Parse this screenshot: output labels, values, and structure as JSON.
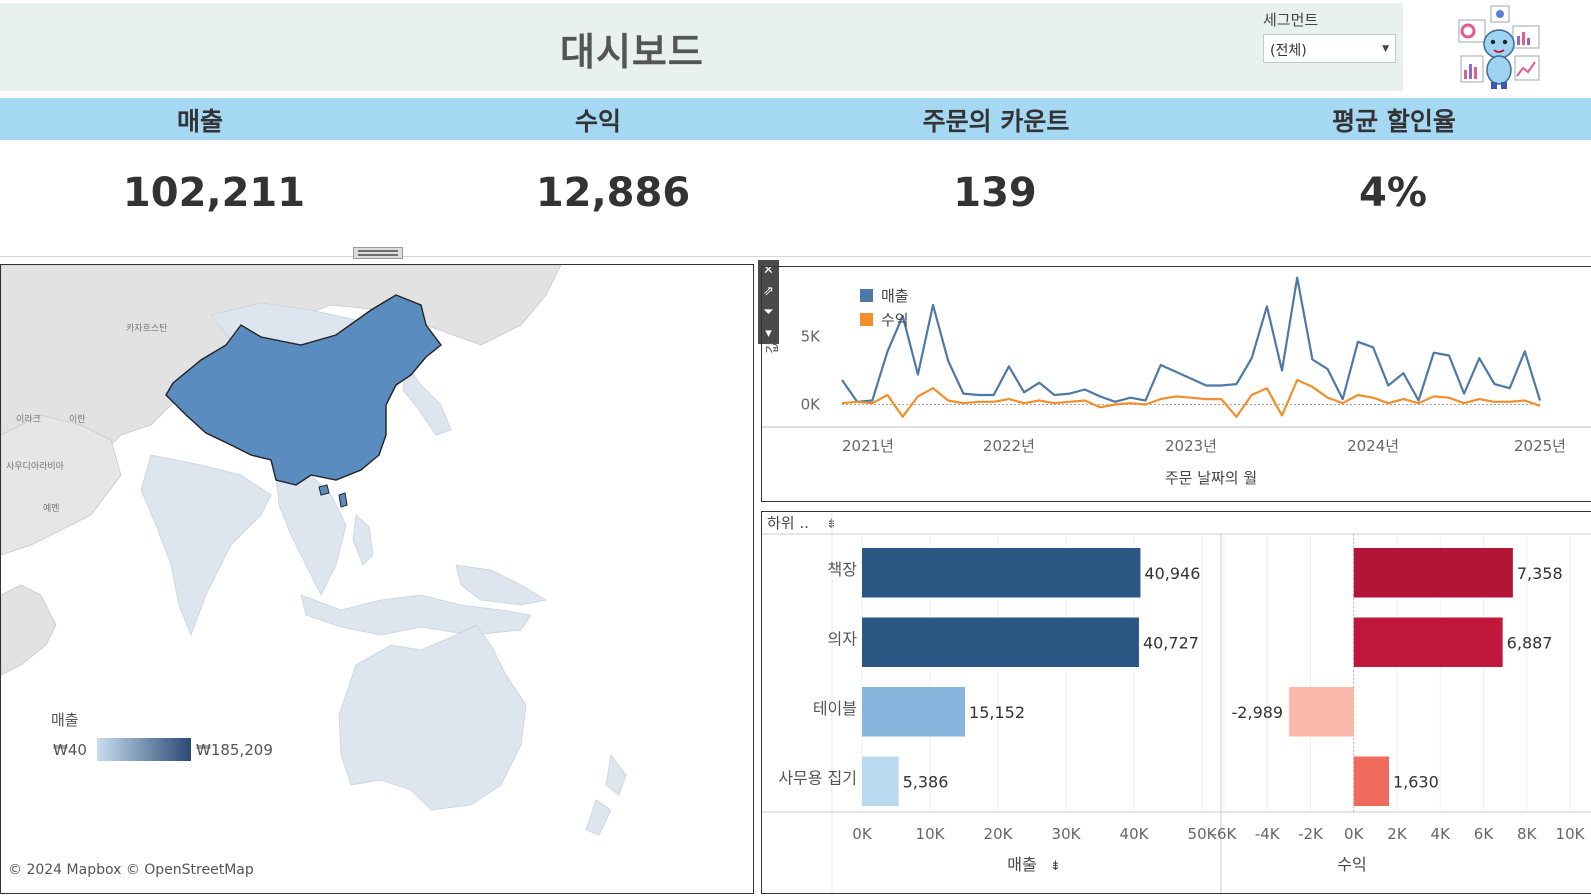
{
  "header": {
    "title": "대시보드",
    "segment_label": "세그먼트",
    "segment_value": "(전체)"
  },
  "kpis": [
    {
      "label": "매출",
      "value": "102,211"
    },
    {
      "label": "수익",
      "value": "12,886"
    },
    {
      "label": "주문의 카운트",
      "value": "139"
    },
    {
      "label": "평균 할인율",
      "value": "4%"
    }
  ],
  "map": {
    "labels": {
      "kazakhstan": "카자흐스탄",
      "iraq": "이라크",
      "iran": "이란",
      "saudi": "사우디아라비아",
      "yemen": "예멘"
    },
    "legend_title": "매출",
    "legend_min": "₩40",
    "legend_max": "₩185,209",
    "attribution": "© 2024 Mapbox © OpenStreetMap",
    "colors": {
      "highlight": "#5b8cc0",
      "light": "#dde5ee",
      "land": "#e2e2e2",
      "legend_low": "#c6dcef",
      "legend_high": "#2a4a73"
    }
  },
  "chart_data": [
    {
      "type": "line",
      "xlabel": "주문 날짜의 월",
      "ylabel": "값",
      "x_ticks": [
        "2021년",
        "2022년",
        "2023년",
        "2024년",
        "2025년"
      ],
      "y_ticks": [
        "0K",
        "5K"
      ],
      "ylim": [
        -1500,
        9500
      ],
      "legend_placement": "top-left",
      "series": [
        {
          "name": "매출",
          "color": "#4e79a7",
          "values": [
            1800,
            200,
            300,
            3900,
            6500,
            2200,
            7300,
            3200,
            800,
            700,
            700,
            2800,
            900,
            1600,
            700,
            800,
            1100,
            600,
            200,
            500,
            300,
            2900,
            2400,
            1900,
            1400,
            1400,
            1500,
            3400,
            7200,
            2500,
            9300,
            3300,
            2600,
            400,
            4600,
            4200,
            1400,
            2300,
            300,
            3800,
            3600,
            800,
            3400,
            1500,
            1200,
            3900,
            300
          ]
        },
        {
          "name": "수익",
          "color": "#f28e2b",
          "values": [
            100,
            200,
            100,
            700,
            -900,
            600,
            1200,
            300,
            100,
            200,
            200,
            400,
            100,
            300,
            100,
            200,
            300,
            -200,
            0,
            100,
            0,
            400,
            600,
            500,
            400,
            400,
            -900,
            700,
            1200,
            -800,
            1800,
            1300,
            500,
            100,
            700,
            500,
            100,
            400,
            100,
            600,
            500,
            100,
            400,
            200,
            200,
            300,
            -100
          ]
        }
      ]
    },
    {
      "type": "bar",
      "header_label": "하위 ..",
      "categories": [
        "책장",
        "의자",
        "테이블",
        "사무용 집기"
      ],
      "series": [
        {
          "name": "매출",
          "values": [
            40946,
            40727,
            15152,
            5386
          ],
          "value_labels": [
            "40,946",
            "40,727",
            "15,152",
            "5,386"
          ],
          "colors": [
            "#2a5783",
            "#2a5783",
            "#85b4dc",
            "#b8d9f0"
          ],
          "xlim": [
            0,
            50000
          ],
          "x_ticks": [
            "0K",
            "10K",
            "20K",
            "30K",
            "40K",
            "50K"
          ],
          "xlabel": "매출"
        },
        {
          "name": "수익",
          "values": [
            7358,
            6887,
            -2989,
            1630
          ],
          "value_labels": [
            "7,358",
            "6,887",
            "-2,989",
            "1,630"
          ],
          "colors": [
            "#b31536",
            "#c0183a",
            "#fbb8aa",
            "#f06b5c"
          ],
          "xlim": [
            -6000,
            10000
          ],
          "x_ticks": [
            "-6K",
            "-4K",
            "-2K",
            "0K",
            "2K",
            "4K",
            "6K",
            "8K",
            "10K"
          ],
          "xlabel": "수익"
        }
      ]
    }
  ]
}
